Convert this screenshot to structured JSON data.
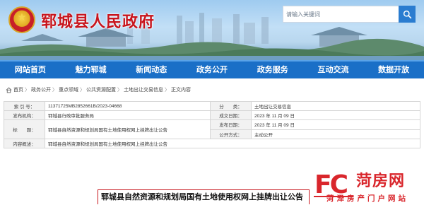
{
  "header": {
    "site_title": "郓城县人民政府",
    "emblem": "national-emblem-icon",
    "search": {
      "placeholder": "请输入关键词",
      "icon": "search-icon"
    }
  },
  "nav": {
    "items": [
      {
        "label": "网站首页"
      },
      {
        "label": "魅力郓城"
      },
      {
        "label": "新闻动态"
      },
      {
        "label": "政务公开"
      },
      {
        "label": "政务服务"
      },
      {
        "label": "互动交流"
      },
      {
        "label": "数据开放"
      }
    ]
  },
  "breadcrumb": {
    "prefix": "首页",
    "items": [
      "政务公开",
      "重点领域",
      "公共资源配置",
      "土地出让交易信息",
      "正文内容"
    ],
    "separator": "〉"
  },
  "info": {
    "index_label": "索 引 号：",
    "index_value": "11371725MB2852661B/2023-04668",
    "category_label": "分　　类：",
    "category_value": "土地出让交易信息",
    "issuer_label": "发布机构：",
    "issuer_value": "郓城县行政审批服务局",
    "created_label": "成文日期：",
    "created_value": "2023 年 11 月 09 日",
    "published_label": "发布日期：",
    "published_value": "2023 年 11 月 09 日",
    "title_label": "标　　题：",
    "title_value": "郓城县自然资源和规划局国有土地使用权网上挂牌出让公告",
    "open_label": "公开方式：",
    "open_value": "主动公开",
    "summary_label": "内容概述：",
    "summary_value": "郓城县自然资源和规划局国有土地使用权网上挂牌出让公告"
  },
  "article": {
    "title": "郓城县自然资源和规划局国有土地使用权网上挂牌出让公告"
  },
  "watermark": {
    "logo_letters": "FC",
    "site_name": "菏房网",
    "tagline": "菏泽房产门户网站"
  },
  "colors": {
    "brand_red": "#c8151d",
    "nav_blue": "#1a6fc7",
    "search_button": "#2a7cd0",
    "watermark_red": "#d9262c"
  }
}
